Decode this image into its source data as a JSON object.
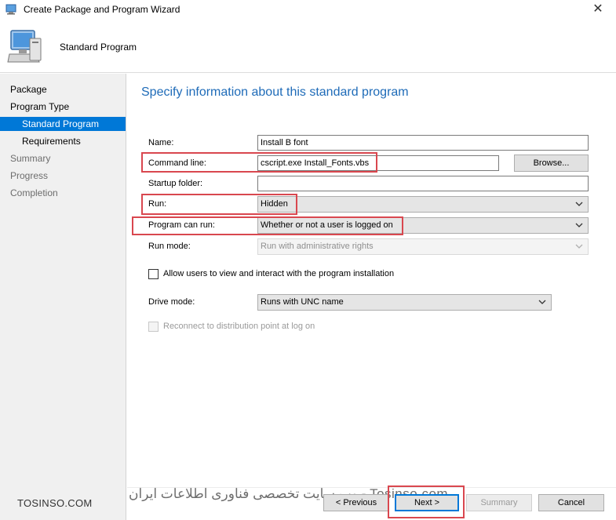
{
  "window": {
    "title": "Create Package and Program Wizard",
    "close_glyph": "✕"
  },
  "header": {
    "title": "Standard Program",
    "icon": "computer-wizard-icon"
  },
  "nav": {
    "items": [
      {
        "label": "Package",
        "state": "done"
      },
      {
        "label": "Program Type",
        "state": "done"
      },
      {
        "label": "Standard Program",
        "state": "active"
      },
      {
        "label": "Requirements",
        "state": "done"
      },
      {
        "label": "Summary",
        "state": "pending"
      },
      {
        "label": "Progress",
        "state": "pending"
      },
      {
        "label": "Completion",
        "state": "pending"
      }
    ]
  },
  "main": {
    "title": "Specify information about this standard program",
    "fields": {
      "name": {
        "label": "Name:",
        "value": "Install B font"
      },
      "command_line": {
        "label": "Command line:",
        "value": "cscript.exe Install_Fonts.vbs"
      },
      "browse": {
        "label": "Browse..."
      },
      "startup_folder": {
        "label": "Startup folder:",
        "value": ""
      },
      "run": {
        "label": "Run:",
        "value": "Hidden"
      },
      "program_can_run": {
        "label": "Program can run:",
        "value": "Whether or not a user is logged on"
      },
      "run_mode": {
        "label": "Run mode:",
        "value": "Run with administrative rights"
      },
      "allow_interact": {
        "label": "Allow users to view and interact with the program installation",
        "checked": false
      },
      "drive_mode": {
        "label": "Drive mode:",
        "value": "Runs with UNC name"
      },
      "reconnect": {
        "label": "Reconnect to distribution point at log on",
        "checked": false
      }
    }
  },
  "footer": {
    "previous": "< Previous",
    "next": "Next >",
    "summary": "Summary",
    "cancel": "Cancel"
  },
  "watermark": {
    "left": "TOSINSO.COM",
    "center": "وب سایت تخصصی فناوری اطلاعات ایران - Tosinso.com"
  },
  "colors": {
    "accent": "#0078d7",
    "title_blue": "#1e6bb8",
    "highlight_red": "#d9474f"
  }
}
